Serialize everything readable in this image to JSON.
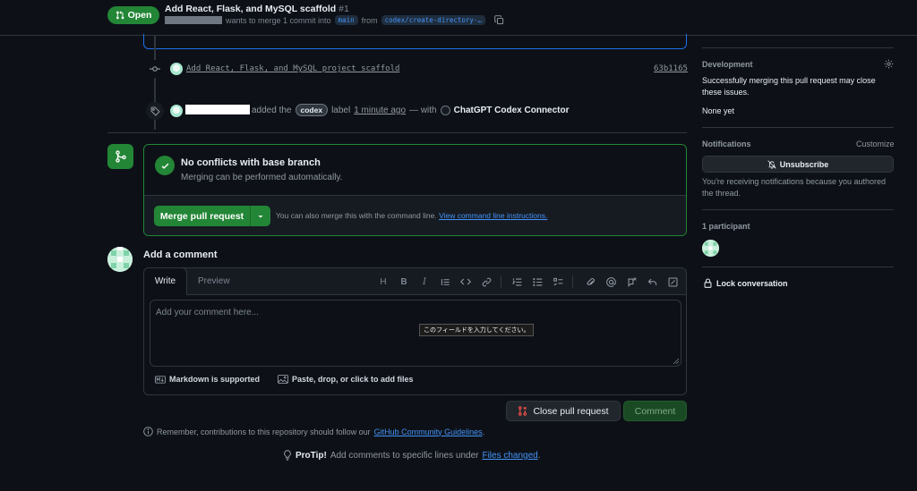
{
  "header": {
    "state": "Open",
    "title": "Add React, Flask, and MySQL scaffold",
    "number": "#1",
    "merge_text": "wants to merge 1 commit into",
    "base_branch": "main",
    "from_text": "from",
    "head_branch": "codex/create-directory-…"
  },
  "timeline": {
    "commit_message": "Add React, Flask, and MySQL project scaffold",
    "commit_sha": "63b1165",
    "label_event": {
      "action": "added the",
      "label": "codex",
      "suffix": "label",
      "time": "1 minute ago",
      "with_text": "— with",
      "app": "ChatGPT Codex Connector"
    }
  },
  "merge": {
    "title": "No conflicts with base branch",
    "subtitle": "Merging can be performed automatically.",
    "button": "Merge pull request",
    "hint": "You can also merge this with the command line.",
    "hint_link": "View command line instructions."
  },
  "comment": {
    "heading": "Add a comment",
    "tab_write": "Write",
    "tab_preview": "Preview",
    "placeholder": "Add your comment here...",
    "validation_tooltip": "このフィールドを入力してください。",
    "markdown_note": "Markdown is supported",
    "attach_note": "Paste, drop, or click to add files",
    "close_button": "Close pull request",
    "comment_button": "Comment",
    "guidelines_prefix": "Remember, contributions to this repository should follow our",
    "guidelines_link": "GitHub Community Guidelines",
    "guidelines_suffix": ".",
    "protip_label": "ProTip!",
    "protip_text": "Add comments to specific lines under",
    "protip_link": "Files changed",
    "protip_suffix": "."
  },
  "sidebar": {
    "development_heading": "Development",
    "development_text": "Successfully merging this pull request may close these issues.",
    "development_none": "None yet",
    "notifications_heading": "Notifications",
    "customize": "Customize",
    "unsubscribe": "Unsubscribe",
    "notifications_text": "You're receiving notifications because you authored the thread.",
    "participants_heading": "1 participant",
    "lock": "Lock conversation"
  },
  "colors": {
    "bg": "#0d1117",
    "accent_green": "#238636",
    "link_blue": "#4493f8",
    "border": "#30363d",
    "close_red": "#f85149"
  },
  "icons": [
    "git-pull-request-icon",
    "copy-icon",
    "git-commit-icon",
    "tag-icon",
    "git-merge-icon",
    "check-icon",
    "triangle-down-icon",
    "gear-icon",
    "bell-slash-icon",
    "lock-icon",
    "info-icon",
    "light-bulb-icon",
    "markdown-icon",
    "image-icon"
  ]
}
